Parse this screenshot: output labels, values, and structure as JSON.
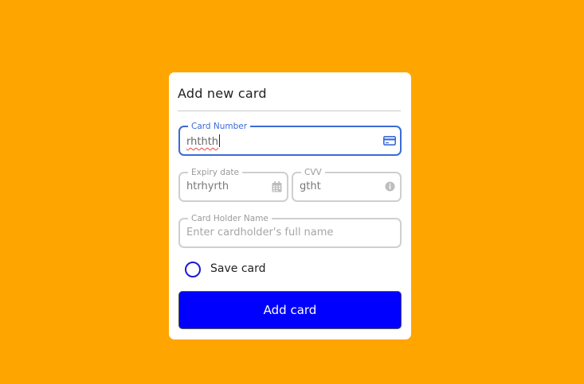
{
  "form": {
    "title": "Add new card",
    "card_number": {
      "label": "Card Number",
      "value": "rhthth",
      "icon": "credit-card-icon"
    },
    "expiry": {
      "label": "Expiry date",
      "value": "htrhyrth",
      "icon": "calendar-icon"
    },
    "cvv": {
      "label": "CVV",
      "value": "gtht",
      "icon": "info-icon"
    },
    "holder": {
      "label": "Card Holder Name",
      "placeholder": "Enter cardholder's full name"
    },
    "save_card_label": "Save card",
    "submit_label": "Add card"
  },
  "colors": {
    "background": "#FFA500",
    "accent": "#0000FF",
    "focus": "#3B6BD6"
  }
}
